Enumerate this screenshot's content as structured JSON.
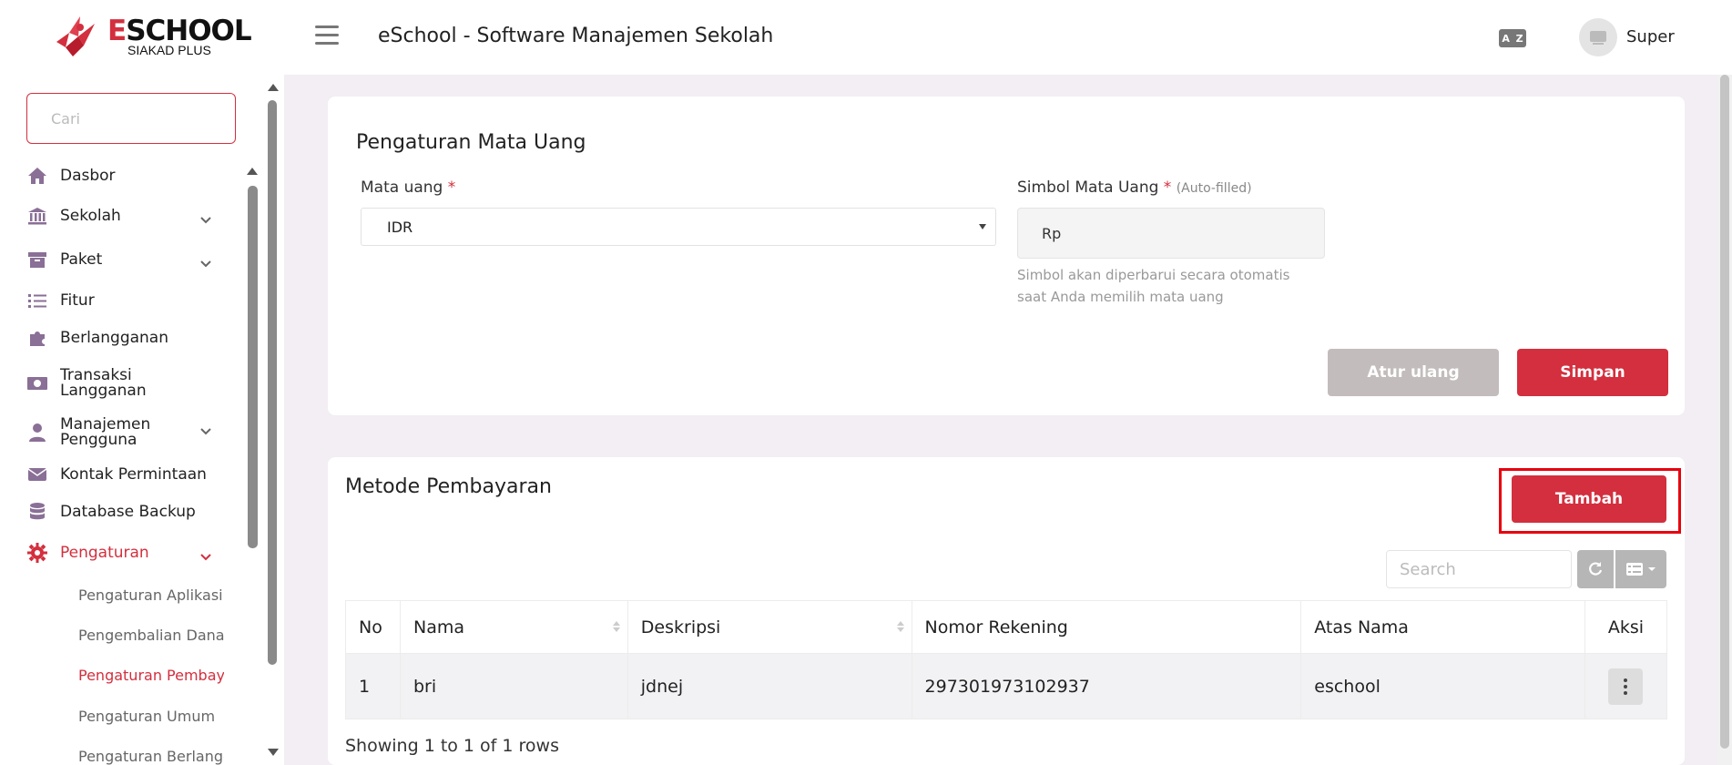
{
  "header": {
    "brand_e": "E",
    "brand_rest": "SCHOOL",
    "brand_sub": "SIAKAD PLUS",
    "app_title": "eSchool - Software Manajemen Sekolah",
    "lang_icon_a": "A",
    "lang_icon_b": "Z",
    "user_name": "Super"
  },
  "sidebar": {
    "search_placeholder": "Cari",
    "items": [
      {
        "label": "Dasbor",
        "icon": "home-icon"
      },
      {
        "label": "Sekolah",
        "icon": "bank-icon"
      },
      {
        "label": "Paket",
        "icon": "archive-icon"
      },
      {
        "label": "Fitur",
        "icon": "list-icon"
      },
      {
        "label": "Berlangganan",
        "icon": "puzzle-icon"
      },
      {
        "label": "Transaksi Langganan",
        "icon": "money-icon"
      },
      {
        "label": "Manajemen Pengguna",
        "icon": "user-tie-icon"
      },
      {
        "label": "Kontak Permintaan",
        "icon": "envelope-icon"
      },
      {
        "label": "Database Backup",
        "icon": "database-icon"
      },
      {
        "label": "Pengaturan",
        "icon": "gear-icon"
      }
    ],
    "sub_items": [
      {
        "label": "Pengaturan Aplikasi"
      },
      {
        "label": "Pengembalian Dana"
      },
      {
        "label": "Pengaturan Pembayaran"
      },
      {
        "label": "Pengaturan Umum"
      },
      {
        "label": "Pengaturan Berlangganan"
      }
    ]
  },
  "currency": {
    "title": "Pengaturan Mata Uang",
    "currency_label": "Mata uang",
    "required_mark": "*",
    "currency_value": "IDR",
    "symbol_label": "Simbol Mata Uang",
    "symbol_note": "(Auto-filled)",
    "symbol_value": "Rp",
    "help_text": "Simbol akan diperbarui secara otomatis saat Anda memilih mata uang",
    "reset_label": "Atur ulang",
    "save_label": "Simpan"
  },
  "payment": {
    "title": "Metode Pembayaran",
    "add_label": "Tambah",
    "search_placeholder": "Search",
    "columns": [
      "No",
      "Nama",
      "Deskripsi",
      "Nomor Rekening",
      "Atas Nama",
      "Aksi"
    ],
    "rows": [
      {
        "no": "1",
        "nama": "bri",
        "deskripsi": "jdnej",
        "nomor_rekening": "297301973102937",
        "atas_nama": "eschool"
      }
    ],
    "footer": "Showing 1 to 1 of 1 rows"
  },
  "colors": {
    "accent": "#d32f3e",
    "highlight_box": "#e8000e",
    "muted_button": "#c3bcbc"
  }
}
